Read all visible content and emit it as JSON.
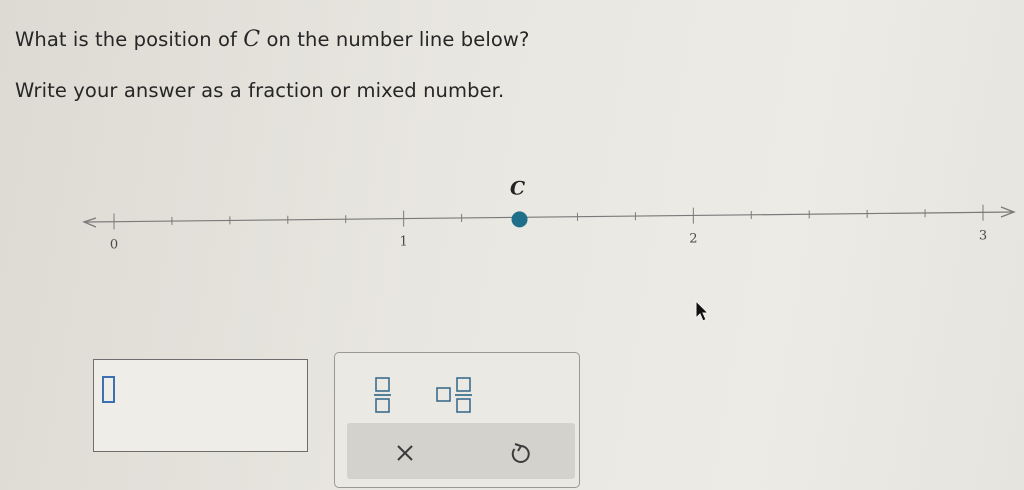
{
  "question": {
    "line1_prefix": "What is the position of ",
    "variable": "C",
    "line1_suffix": " on the number line below?",
    "line2": "Write your answer as a fraction or mixed number."
  },
  "number_line": {
    "min": 0,
    "max": 3,
    "minor_ticks_per_unit": 5,
    "tick_labels": [
      "0",
      "1",
      "2",
      "3"
    ],
    "point": {
      "label": "C",
      "value": 1.4,
      "color": "#1f6f8b"
    }
  },
  "answer": {
    "value": ""
  },
  "keypad": {
    "buttons": [
      "fraction-icon",
      "mixed-number-icon"
    ],
    "actions": [
      "clear-icon",
      "undo-icon"
    ]
  }
}
